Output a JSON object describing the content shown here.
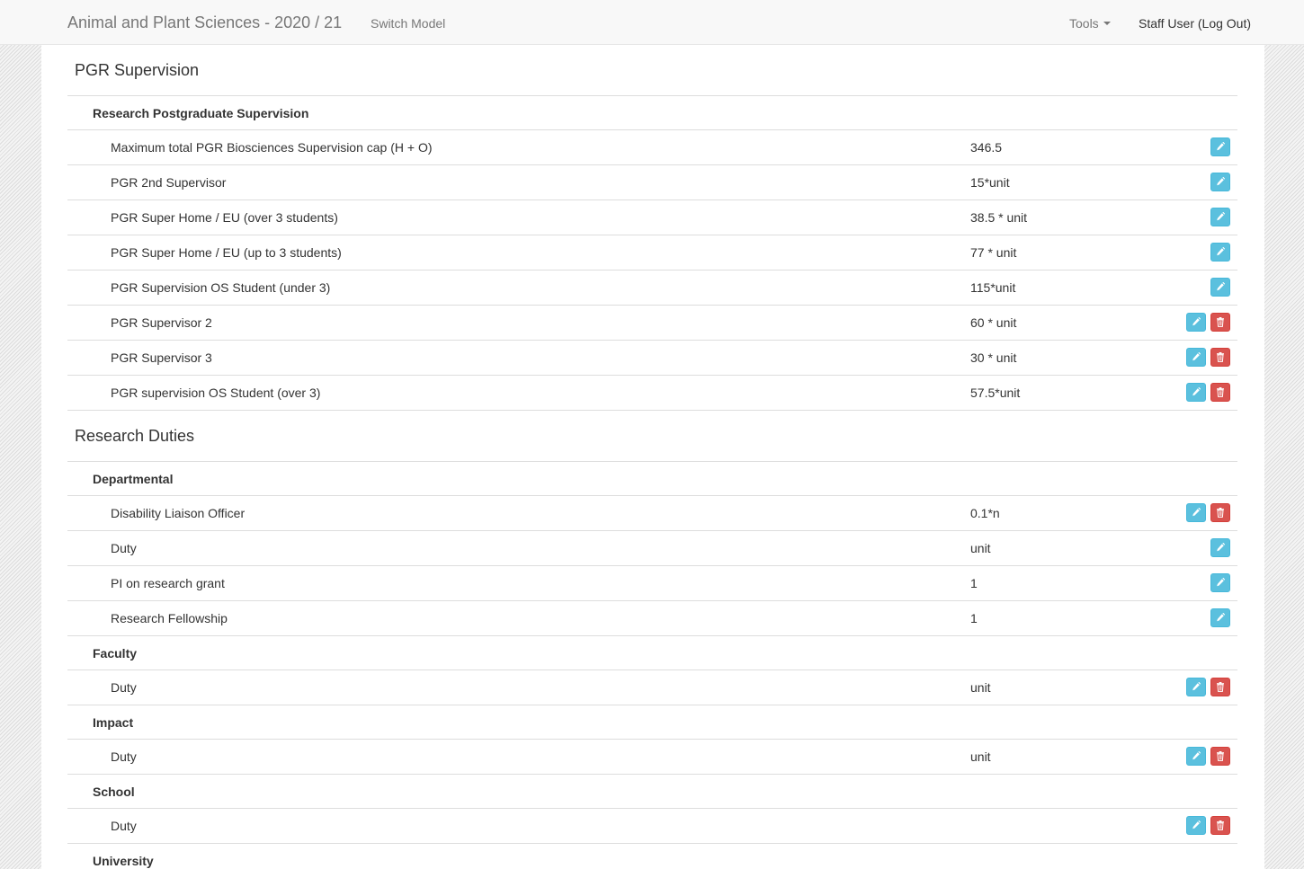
{
  "navbar": {
    "brand": "Animal and Plant Sciences - 2020 / 21",
    "switch_model": "Switch Model",
    "tools": "Tools",
    "user": "Staff User (Log Out)"
  },
  "colors": {
    "edit_button": "#5bc0de",
    "delete_button": "#d9534f"
  },
  "icons": {
    "edit": "pencil-icon",
    "delete": "trash-icon",
    "dropdown": "caret-down-icon"
  },
  "sections": [
    {
      "title": "PGR Supervision",
      "groups": [
        {
          "name": "Research Postgraduate Supervision",
          "items": [
            {
              "name": "Maximum total PGR Biosciences Supervision cap (H + O)",
              "value": "346.5",
              "deletable": false
            },
            {
              "name": "PGR 2nd Supervisor",
              "value": "15*unit",
              "deletable": false
            },
            {
              "name": "PGR Super Home / EU (over 3 students)",
              "value": "38.5 * unit",
              "deletable": false
            },
            {
              "name": "PGR Super Home / EU (up to 3 students)",
              "value": "77 * unit",
              "deletable": false
            },
            {
              "name": "PGR Supervision OS Student (under 3)",
              "value": "115*unit",
              "deletable": false
            },
            {
              "name": "PGR Supervisor 2",
              "value": "60 * unit",
              "deletable": true
            },
            {
              "name": "PGR Supervisor 3",
              "value": "30 * unit",
              "deletable": true
            },
            {
              "name": "PGR supervision OS Student (over 3)",
              "value": "57.5*unit",
              "deletable": true
            }
          ]
        }
      ]
    },
    {
      "title": "Research Duties",
      "groups": [
        {
          "name": "Departmental",
          "items": [
            {
              "name": "Disability Liaison Officer",
              "value": "0.1*n",
              "deletable": true
            },
            {
              "name": "Duty",
              "value": "unit",
              "deletable": false
            },
            {
              "name": "PI on research grant",
              "value": "1",
              "deletable": false
            },
            {
              "name": "Research Fellowship",
              "value": "1",
              "deletable": false
            }
          ]
        },
        {
          "name": "Faculty",
          "items": [
            {
              "name": "Duty",
              "value": "unit",
              "deletable": true
            }
          ]
        },
        {
          "name": "Impact",
          "items": [
            {
              "name": "Duty",
              "value": "unit",
              "deletable": true
            }
          ]
        },
        {
          "name": "School",
          "items": [
            {
              "name": "Duty",
              "value": "",
              "deletable": true
            }
          ]
        },
        {
          "name": "University",
          "items": []
        }
      ]
    }
  ]
}
